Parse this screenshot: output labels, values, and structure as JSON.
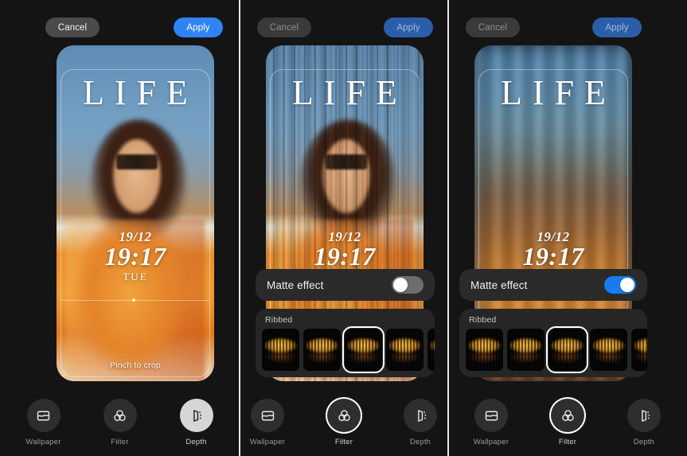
{
  "app": {
    "title": "Wallpaper editor",
    "accent_color": "#2e83f6",
    "toggle_on_color": "#1a7af0",
    "background_color": "#141414"
  },
  "header": {
    "cancel_label": "Cancel",
    "apply_label": "Apply"
  },
  "lockscreen": {
    "magazine_title": "LIFE",
    "date": "19/12",
    "time": "19:17",
    "day_of_week": "TUE",
    "hint": "Pinch to crop"
  },
  "matte": {
    "label": "Matte effect",
    "state_panel1": "hidden",
    "state_panel2": "off",
    "state_panel3": "on"
  },
  "carousel": {
    "name": "Ribbed",
    "selected_index": 2,
    "thumbs": [
      {
        "name": "ribbed-preset-1"
      },
      {
        "name": "ribbed-preset-2"
      },
      {
        "name": "ribbed-preset-3"
      },
      {
        "name": "ribbed-preset-4"
      },
      {
        "name": "ribbed-preset-5"
      }
    ]
  },
  "tools": [
    {
      "label": "Wallpaper",
      "icon": "wallpaper-icon"
    },
    {
      "label": "Filter",
      "icon": "filter-circles-icon"
    },
    {
      "label": "Depth",
      "icon": "depth-icon"
    }
  ],
  "panels": [
    {
      "name": "panel-crop",
      "active_tool": "Depth",
      "active_style": "fill"
    },
    {
      "name": "panel-filter-matte-off",
      "active_tool": "Filter",
      "active_style": "ring"
    },
    {
      "name": "panel-filter-matte-on",
      "active_tool": "Filter",
      "active_style": "ring"
    }
  ]
}
